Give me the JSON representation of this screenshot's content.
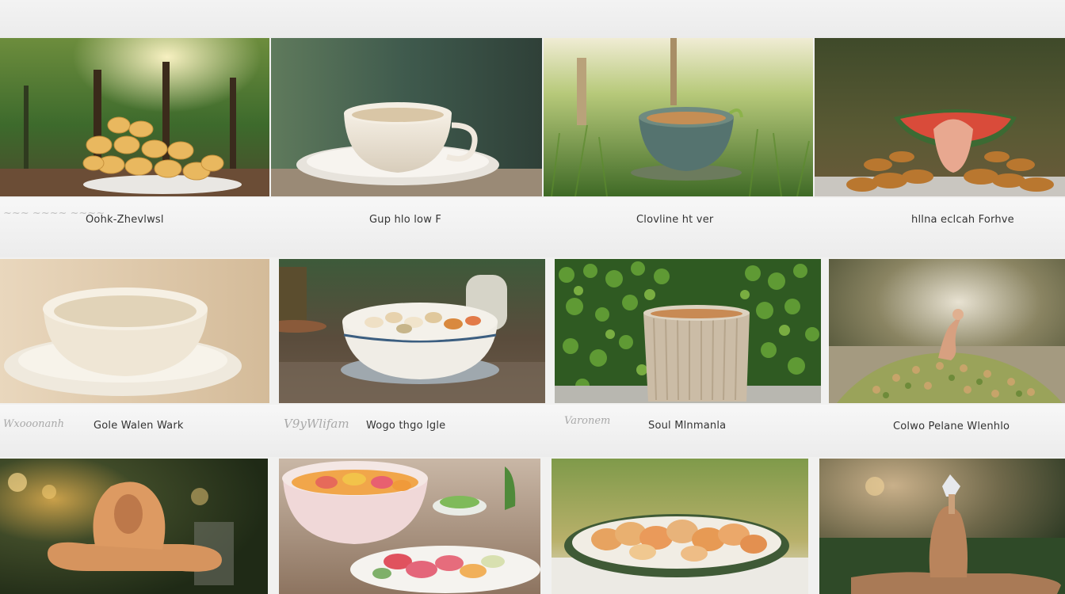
{
  "gallery": {
    "row1": [
      {
        "caption": "Oohk-Zhevlwsl"
      },
      {
        "caption": "Gup  hlo low F"
      },
      {
        "caption": "Clovline ht ver"
      },
      {
        "caption": "hllna eclcah Forhve"
      }
    ],
    "row2": [
      {
        "caption": "Gole Walen Wark",
        "scribble": "Wxooonanh"
      },
      {
        "caption": "Wogo thgo lgle",
        "scribble": "V9yWlifam"
      },
      {
        "caption": "Soul Mlnmanla",
        "scribble": "Varonem"
      },
      {
        "caption": "Colwo Pelane Wlenhlo"
      }
    ]
  }
}
